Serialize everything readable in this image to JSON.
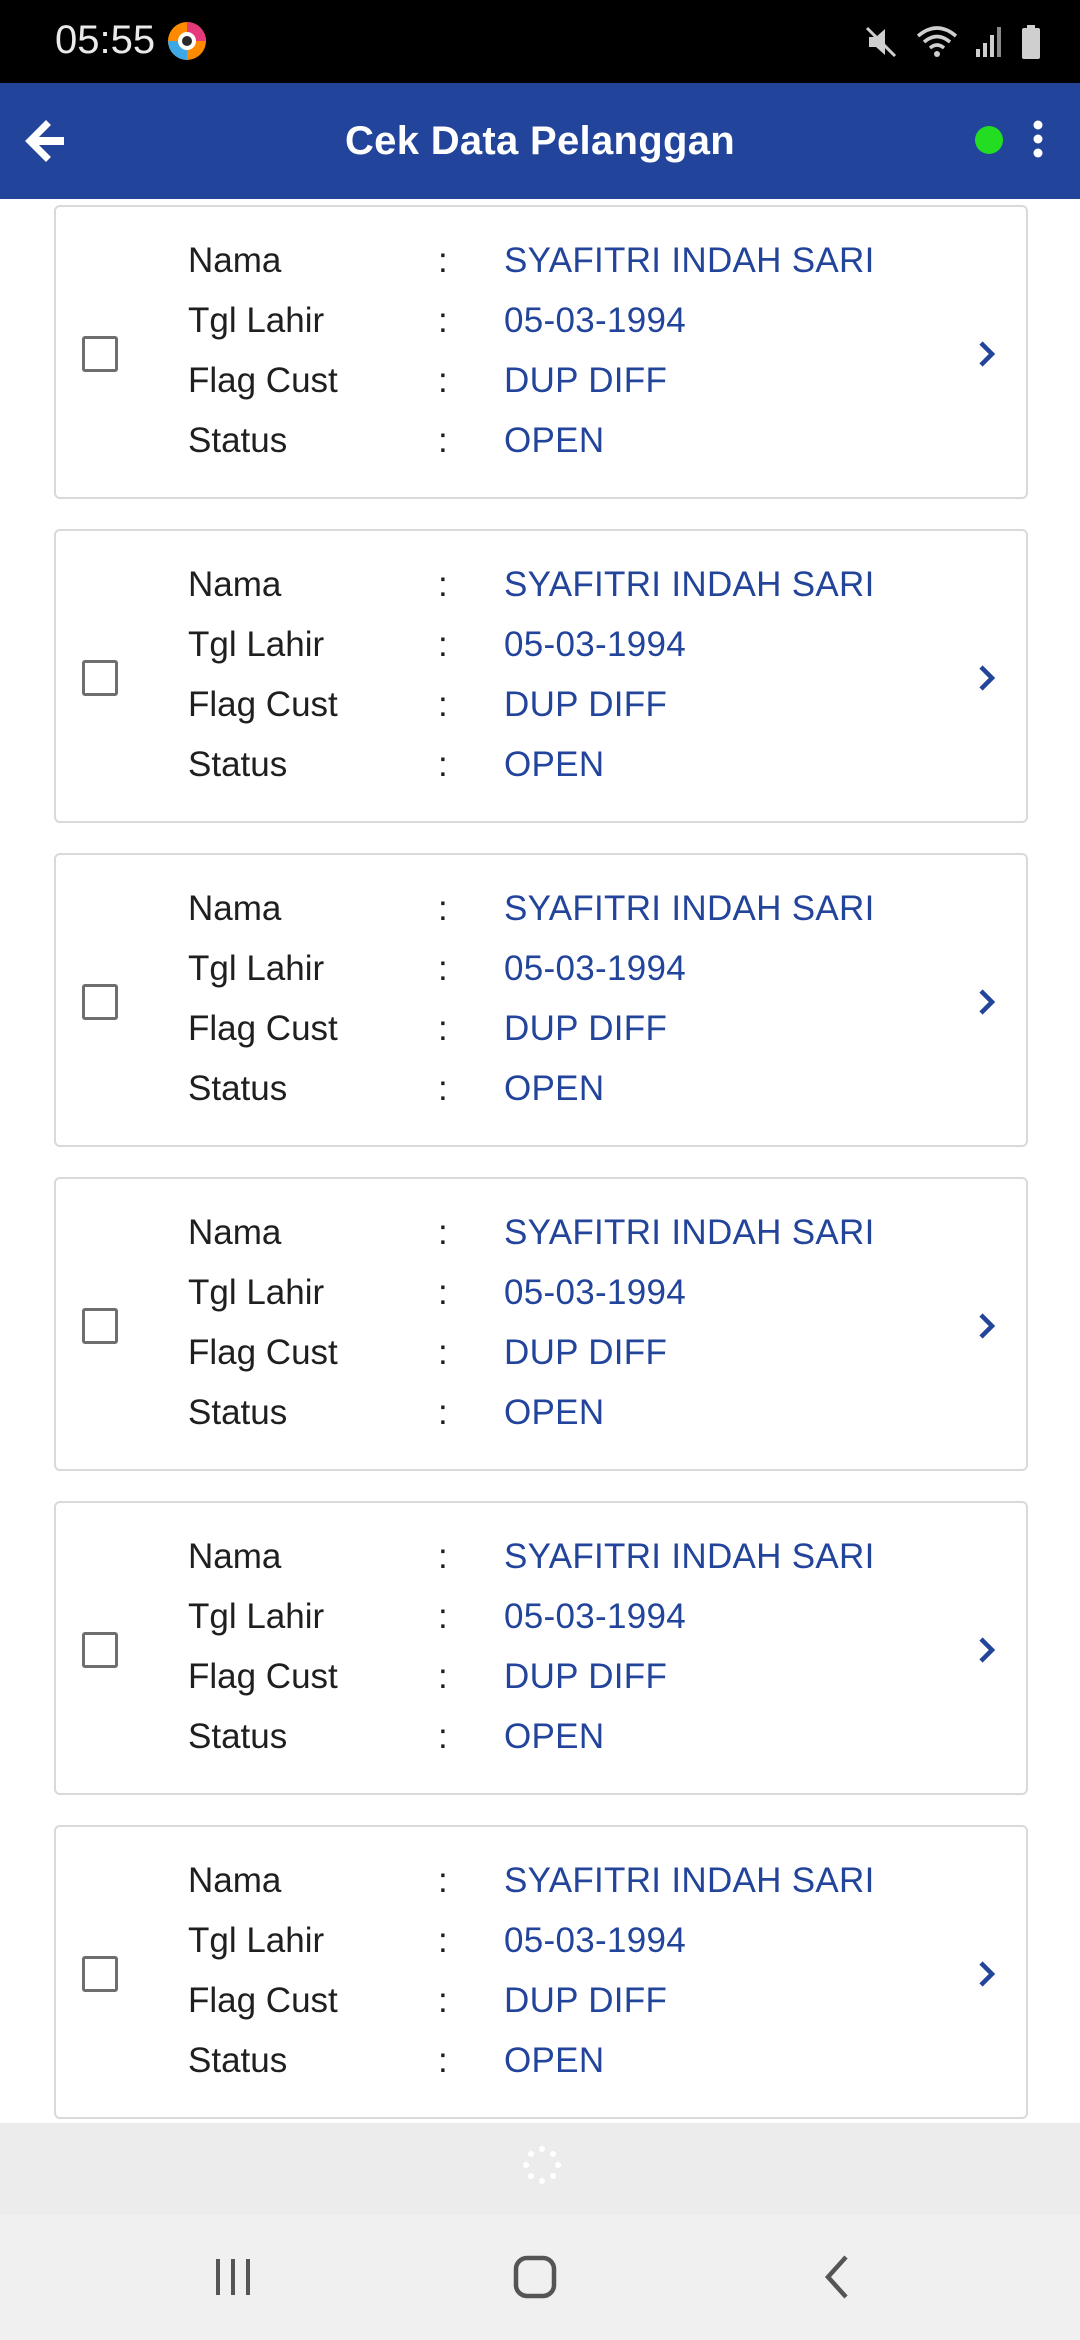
{
  "status_bar": {
    "time": "05:55",
    "icons": [
      "app-icon",
      "mute-icon",
      "wifi-icon",
      "signal-icon",
      "battery-icon"
    ]
  },
  "app_bar": {
    "title": "Cek Data Pelanggan",
    "online_indicator_color": "#22dd22",
    "background_color": "#22449a"
  },
  "labels": {
    "nama": "Nama",
    "tgl_lahir": "Tgl Lahir",
    "flag_cust": "Flag Cust",
    "status": "Status",
    "separator": ":"
  },
  "customers": [
    {
      "nama": "SYAFITRI INDAH SARI",
      "tgl_lahir": "05-03-1994",
      "flag_cust": "DUP DIFF",
      "status": "OPEN",
      "checked": false
    },
    {
      "nama": "SYAFITRI INDAH SARI",
      "tgl_lahir": "05-03-1994",
      "flag_cust": "DUP DIFF",
      "status": "OPEN",
      "checked": false
    },
    {
      "nama": "SYAFITRI INDAH SARI",
      "tgl_lahir": "05-03-1994",
      "flag_cust": "DUP DIFF",
      "status": "OPEN",
      "checked": false
    },
    {
      "nama": "SYAFITRI INDAH SARI",
      "tgl_lahir": "05-03-1994",
      "flag_cust": "DUP DIFF",
      "status": "OPEN",
      "checked": false
    },
    {
      "nama": "SYAFITRI INDAH SARI",
      "tgl_lahir": "05-03-1994",
      "flag_cust": "DUP DIFF",
      "status": "OPEN",
      "checked": false
    },
    {
      "nama": "SYAFITRI INDAH SARI",
      "tgl_lahir": "05-03-1994",
      "flag_cust": "DUP DIFF",
      "status": "OPEN",
      "checked": false
    }
  ],
  "nav_bar": {
    "buttons": [
      "recent-apps-icon",
      "home-icon",
      "back-nav-icon"
    ]
  }
}
